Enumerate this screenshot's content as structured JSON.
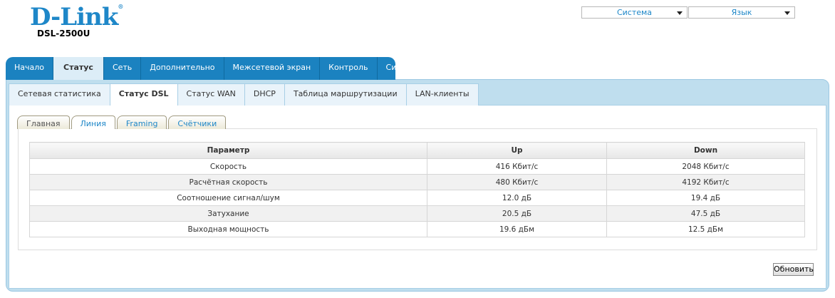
{
  "brand": {
    "logo": "D-Link",
    "model": "DSL-2500U"
  },
  "header_selects": {
    "system": "Система",
    "language": "Язык"
  },
  "nav": [
    "Начало",
    "Статус",
    "Сеть",
    "Дополнительно",
    "Межсетевой экран",
    "Контроль",
    "Система"
  ],
  "subnav": [
    "Сетевая статистика",
    "Статус DSL",
    "Статус WAN",
    "DHCP",
    "Таблица маршрутизации",
    "LAN-клиенты"
  ],
  "tabs": [
    "Главная",
    "Линия",
    "Framing",
    "Счётчики"
  ],
  "table": {
    "headers": [
      "Параметр",
      "Up",
      "Down"
    ],
    "rows": [
      [
        "Скорость",
        "416 Кбит/с",
        "2048 Кбит/с"
      ],
      [
        "Расчётная скорость",
        "480 Кбит/с",
        "4192 Кбит/с"
      ],
      [
        "Соотношение сигнал/шум",
        "12.0 дБ",
        "19.4 дБ"
      ],
      [
        "Затухание",
        "20.5 дБ",
        "47.5 дБ"
      ],
      [
        "Выходная мощность",
        "19.6 дБм",
        "12.5 дБм"
      ]
    ]
  },
  "refresh_label": "Обновить"
}
